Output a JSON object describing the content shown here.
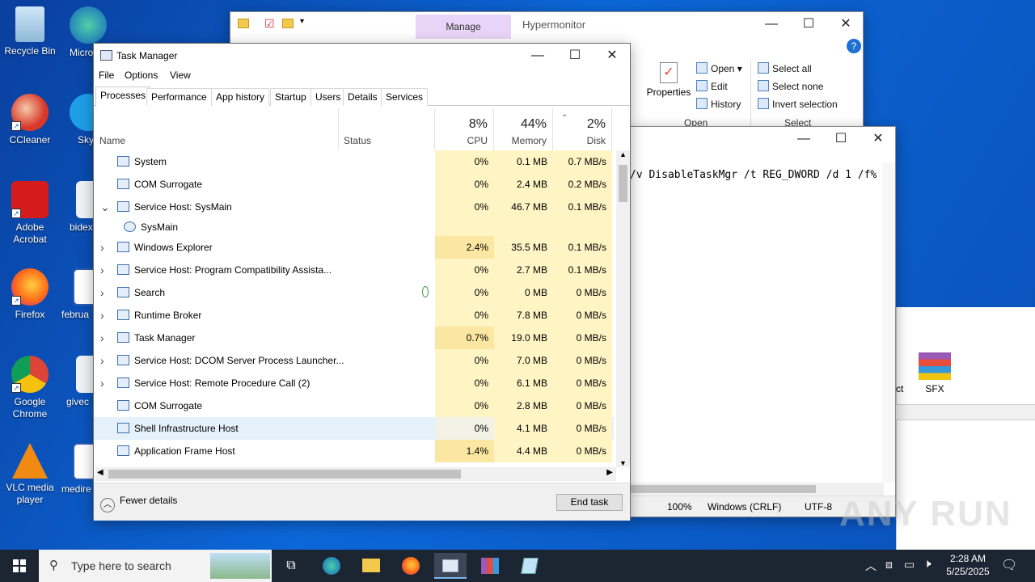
{
  "desktop": {
    "icons": [
      {
        "label": "Recycle Bin",
        "icon": "recycle-bin-icon"
      },
      {
        "label": "CCleaner",
        "icon": "ccleaner-icon"
      },
      {
        "label": "Adobe Acrobat",
        "icon": "acrobat-icon"
      },
      {
        "label": "Firefox",
        "icon": "firefox-icon"
      },
      {
        "label": "Google Chrome",
        "icon": "chrome-icon"
      },
      {
        "label": "VLC media player",
        "icon": "vlc-icon"
      }
    ],
    "partial_icons": [
      "Micro Ed",
      "Sky",
      "bidex",
      "februa",
      "givec",
      "medire"
    ]
  },
  "explorer": {
    "ribbon_tab": "Manage",
    "title": "Hypermonitor",
    "properties": "Properties",
    "open": "Open",
    "edit": "Edit",
    "history": "History",
    "open_group": "Open",
    "select_all": "Select all",
    "select_none": "Select none",
    "invert_selection": "Invert selection",
    "select_group": "Select",
    "right_items": [
      "ct",
      "SFX"
    ]
  },
  "notepad": {
    "text": "/v DisableTaskMgr /t REG_DWORD /d 1 /f%",
    "status": {
      "zoom": "100%",
      "line_ending": "Windows (CRLF)",
      "encoding": "UTF-8"
    }
  },
  "taskmgr": {
    "title": "Task Manager",
    "menu": [
      "File",
      "Options",
      "View"
    ],
    "tabs": [
      "Processes",
      "Performance",
      "App history",
      "Startup",
      "Users",
      "Details",
      "Services"
    ],
    "columns": {
      "name": "Name",
      "status": "Status",
      "cpu_pct": "8%",
      "cpu": "CPU",
      "mem_pct": "44%",
      "mem": "Memory",
      "disk_pct": "2%",
      "disk": "Disk"
    },
    "rows": [
      {
        "name": "System",
        "expander": "",
        "cpu": "0%",
        "mem": "0.1 MB",
        "disk": "0.7 MB/s"
      },
      {
        "name": "COM Surrogate",
        "expander": "",
        "cpu": "0%",
        "mem": "2.4 MB",
        "disk": "0.2 MB/s"
      },
      {
        "name": "Service Host: SysMain",
        "expander": "⌄",
        "cpu": "0%",
        "mem": "46.7 MB",
        "disk": "0.1 MB/s"
      },
      {
        "name": "SysMain",
        "expander": "",
        "cpu": "",
        "mem": "",
        "disk": "",
        "child": true
      },
      {
        "name": "Windows Explorer",
        "expander": "›",
        "cpu": "2.4%",
        "mem": "35.5 MB",
        "disk": "0.1 MB/s"
      },
      {
        "name": "Service Host: Program Compatibility Assista...",
        "expander": "›",
        "cpu": "0%",
        "mem": "2.7 MB",
        "disk": "0.1 MB/s"
      },
      {
        "name": "Search",
        "expander": "›",
        "cpu": "0%",
        "mem": "0 MB",
        "disk": "0 MB/s",
        "status_icon": "leaf-icon"
      },
      {
        "name": "Runtime Broker",
        "expander": "›",
        "cpu": "0%",
        "mem": "7.8 MB",
        "disk": "0 MB/s"
      },
      {
        "name": "Task Manager",
        "expander": "›",
        "cpu": "0.7%",
        "mem": "19.0 MB",
        "disk": "0 MB/s"
      },
      {
        "name": "Service Host: DCOM Server Process Launcher...",
        "expander": "›",
        "cpu": "0%",
        "mem": "7.0 MB",
        "disk": "0 MB/s"
      },
      {
        "name": "Service Host: Remote Procedure Call (2)",
        "expander": "›",
        "cpu": "0%",
        "mem": "6.1 MB",
        "disk": "0 MB/s"
      },
      {
        "name": "COM Surrogate",
        "expander": "",
        "cpu": "0%",
        "mem": "2.8 MB",
        "disk": "0 MB/s"
      },
      {
        "name": "Shell Infrastructure Host",
        "expander": "",
        "cpu": "0%",
        "mem": "4.1 MB",
        "disk": "0 MB/s",
        "selected": true
      },
      {
        "name": "Application Frame Host",
        "expander": "",
        "cpu": "1.4%",
        "mem": "4.4 MB",
        "disk": "0 MB/s"
      }
    ],
    "fewer_details": "Fewer details",
    "end_task": "End task"
  },
  "taskbar": {
    "search_placeholder": "Type here to search",
    "time": "2:28 AM",
    "date": "5/25/2025"
  },
  "watermark": "ANY RUN",
  "colors": {
    "cpu_heat": "#fff4c4",
    "cpu_heat_strong": "#fbe7a1",
    "selected_row": "#e5f1fb",
    "accent": "#0078d7"
  }
}
